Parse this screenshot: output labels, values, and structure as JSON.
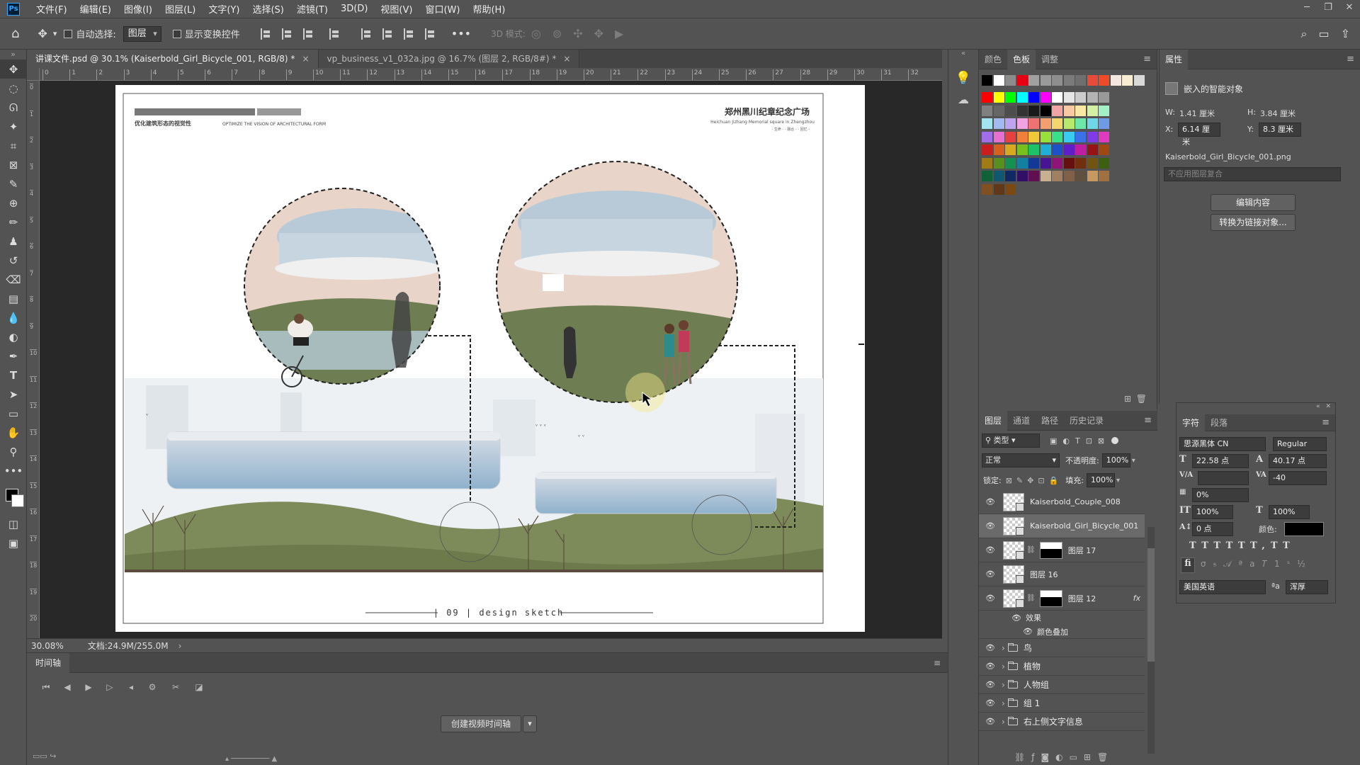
{
  "menu": {
    "app_logo": "Ps",
    "items": [
      "文件(F)",
      "编辑(E)",
      "图像(I)",
      "图层(L)",
      "文字(Y)",
      "选择(S)",
      "滤镜(T)",
      "3D(D)",
      "视图(V)",
      "窗口(W)",
      "帮助(H)"
    ]
  },
  "options": {
    "auto_select_label": "自动选择:",
    "auto_select_target": "图层",
    "show_transform_label": "显示变换控件",
    "mode_3d_label": "3D 模式:"
  },
  "doc_tabs": [
    {
      "label": "讲课文件.psd @ 30.1% (Kaiserbold_Girl_Bicycle_001, RGB/8) *"
    },
    {
      "label": "vp_business_v1_032a.jpg @ 16.7% (图层 2, RGB/8#) *"
    }
  ],
  "ruler_marks": [
    "0",
    "1",
    "2",
    "3",
    "4",
    "5",
    "6",
    "7",
    "8",
    "9",
    "10",
    "11",
    "12",
    "13",
    "14",
    "15",
    "16",
    "17",
    "18",
    "19",
    "20",
    "21",
    "22",
    "23",
    "24",
    "25",
    "26",
    "27",
    "28",
    "29",
    "30",
    "31",
    "32"
  ],
  "ruler_v_marks": [
    "0",
    "1",
    "2",
    "3",
    "4",
    "5",
    "6",
    "7",
    "8",
    "9",
    "10",
    "11",
    "12",
    "13",
    "14",
    "15",
    "16",
    "17",
    "18",
    "19",
    "20",
    "21"
  ],
  "artboard": {
    "header_cn": "优化建筑形态的视觉性",
    "header_en": "OPTIMIZE THE VISION OF ARCHITECTURAL FORM",
    "title_cn": "郑州黑川纪章纪念广场",
    "title_en": "Heichuan Jizhang Memorial square in Zhengzhou",
    "title_sub": "- 生命 -    - 融合 -    - 回忆 -",
    "footer": "| 09 | design sketch"
  },
  "status": {
    "zoom": "30.08%",
    "doc_info": "文档:24.9M/255.0M"
  },
  "timeline": {
    "panel_title": "时间轴",
    "create_button": "创建视频时间轴"
  },
  "swatches": {
    "tabs": [
      "颜色",
      "色板",
      "调整"
    ],
    "active_tab": "色板",
    "colors": [
      "#000000",
      "#ffffff",
      "#8c8c8c",
      "#e60012",
      "#a0a0a0",
      "#9a9a9a",
      "#8e8e8e",
      "#7b7b7b",
      "#6f6f6f",
      "#e84b3a",
      "#f04a28",
      "#f4e7e1",
      "#f8ecd3",
      "#d9d9d9",
      "#ff0000",
      "#ffff00",
      "#00ff00",
      "#00ffff",
      "#0000ff",
      "#ff00ff",
      "#ffffff",
      "#e6e6e6",
      "#cccccc",
      "#b3b3b3",
      "#999999",
      "#808080",
      "#666666",
      "#4d4d4d",
      "#333333",
      "#1a1a1a",
      "#000000",
      "#f2a3a3",
      "#f9c9a3",
      "#f9e8a3",
      "#d3f0a3",
      "#a3f0c7",
      "#a3e4f0",
      "#a3baf0",
      "#c0a3f0",
      "#f0a3e0",
      "#f07373",
      "#f4a06e",
      "#f4d56e",
      "#b8e86e",
      "#6ee8a8",
      "#6ed8e8",
      "#6e9ae8",
      "#a06ee8",
      "#e86ed0",
      "#e84040",
      "#f0803a",
      "#f0c83a",
      "#98e03a",
      "#3ae088",
      "#3accf0",
      "#3a70e8",
      "#803ae8",
      "#e03ac0",
      "#c81e1e",
      "#d8601e",
      "#d8a81e",
      "#78c01e",
      "#1ec068",
      "#1eaed8",
      "#1e50c8",
      "#601ec8",
      "#c01ea0",
      "#961414",
      "#a04814",
      "#a07c14",
      "#58901e",
      "#149050",
      "#1480a0",
      "#143896",
      "#481496",
      "#901478",
      "#641010",
      "#703010",
      "#705410",
      "#3c6010",
      "#106038",
      "#105870",
      "#102864",
      "#301064",
      "#601050",
      "#c8b090",
      "#a08060",
      "#806048",
      "#605040",
      "#c89860",
      "#a07040",
      "#805020",
      "#603818",
      "#7a4a12"
    ]
  },
  "layers": {
    "tabs": [
      "图层",
      "通道",
      "路径",
      "历史记录"
    ],
    "active_tab": "图层",
    "kind_filter": "类型",
    "blend_mode": "正常",
    "opacity_label": "不透明度:",
    "opacity_value": "100%",
    "lock_label": "锁定:",
    "fill_label": "填充:",
    "fill_value": "100%",
    "rows": [
      {
        "name": "Kaiserbold_Couple_008"
      },
      {
        "name": "Kaiserbold_Girl_Bicycle_001"
      },
      {
        "name": "图层 17"
      },
      {
        "name": "图层 16"
      },
      {
        "name": "图层 12",
        "fx": "fx"
      }
    ],
    "effects_label": "效果",
    "effect_item": "颜色叠加",
    "groups": [
      "鸟",
      "植物",
      "人物组",
      "组 1",
      "右上侧文字信息"
    ]
  },
  "properties": {
    "tab": "属性",
    "kind": "嵌入的智能对象",
    "w_label": "W:",
    "w_value": "1.41 厘米",
    "h_label": "H:",
    "h_value": "3.84 厘米",
    "x_label": "X:",
    "x_value": "6.14 厘米",
    "y_label": "Y:",
    "y_value": "8.3 厘米",
    "filename": "Kaiserbold_Girl_Bicycle_001.png",
    "comp_placeholder": "不应用图层复合",
    "edit_button": "编辑内容",
    "convert_button": "转换为链接对象..."
  },
  "character": {
    "tabs": [
      "字符",
      "段落"
    ],
    "font_family": "思源黑体 CN",
    "font_style": "Regular",
    "font_size": "22.58 点",
    "leading": "40.17 点",
    "tracking": "-40",
    "scale_pct": "0%",
    "vscale": "100%",
    "hscale": "100%",
    "baseline": "0 点",
    "color_label": "颜色:",
    "language": "美国英语",
    "aa_label": "ªa",
    "aa_mode": "浑厚"
  }
}
